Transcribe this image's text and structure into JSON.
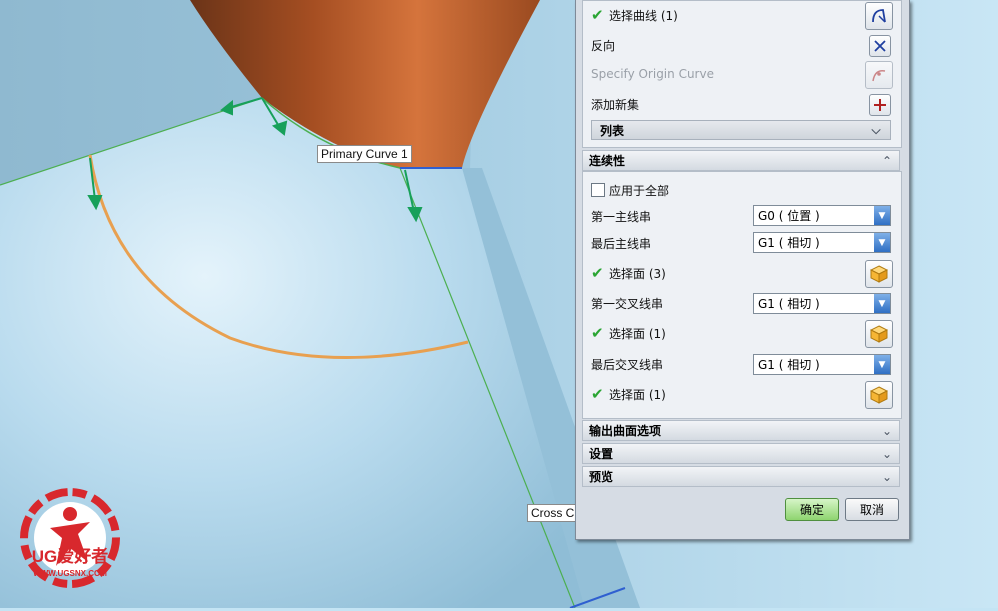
{
  "viewport": {
    "primary_curve_label": "Primary Curve  1",
    "cross_curve_label": "Cross C"
  },
  "logo": {
    "brand": "UG爱好者",
    "url": "WWW.UGSNX.COM"
  },
  "dialog": {
    "select_curve": {
      "label": "选择曲线 (1)",
      "icon": "curve-select-icon"
    },
    "reverse": {
      "label": "反向",
      "icon": "reverse-direction-icon"
    },
    "origin_curve": {
      "label": "Specify Origin Curve",
      "icon": "origin-curve-icon"
    },
    "add_new_set": {
      "label": "添加新集",
      "icon": "add-set-icon"
    },
    "list": {
      "label": "列表"
    },
    "continuity": {
      "title": "连续性",
      "apply_all": {
        "label": "应用于全部",
        "checked": false
      },
      "first_primary": {
        "label": "第一主线串",
        "value": "G0 ( 位置 )"
      },
      "last_primary": {
        "label": "最后主线串",
        "value": "G1 ( 相切 )"
      },
      "select_face_1": {
        "label": "选择面 (3)"
      },
      "first_cross": {
        "label": "第一交叉线串",
        "value": "G1 ( 相切 )"
      },
      "select_face_2": {
        "label": "选择面 (1)"
      },
      "last_cross": {
        "label": "最后交叉线串",
        "value": "G1 ( 相切 )"
      },
      "select_face_3": {
        "label": "选择面 (1)"
      }
    },
    "output_options": {
      "title": "输出曲面选项"
    },
    "settings": {
      "title": "设置"
    },
    "preview": {
      "title": "预览"
    },
    "ok_button": "确定",
    "cancel_button": "取消"
  },
  "colors": {
    "accent_check": "#2aa533",
    "solid_body": "#c8622d",
    "surface": "#b8dcf0",
    "curve_orange": "#e8a050",
    "curve_green": "#4caf50"
  }
}
